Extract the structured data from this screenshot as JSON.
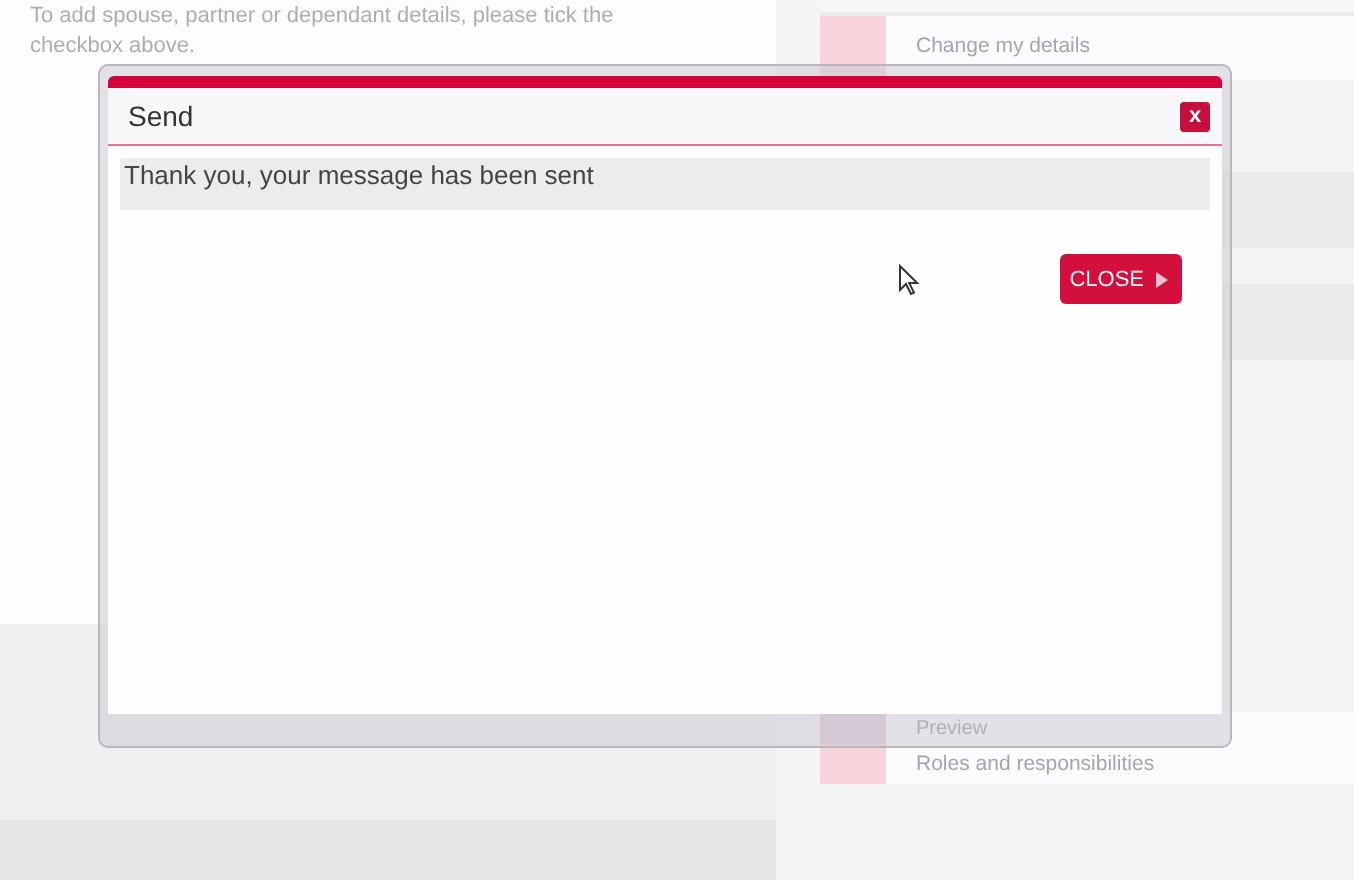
{
  "background_page": {
    "intro_text": "To add spouse, partner or dependant details, please tick the checkbox above.",
    "sidebar_items": [
      {
        "label": "Change my details"
      },
      {
        "label": "Preview"
      },
      {
        "label": "Roles and responsibilities"
      }
    ]
  },
  "dialog": {
    "title": "Send",
    "close_icon_label": "x",
    "message": "Thank you, your message has been sent",
    "button": "CLOSE"
  }
}
